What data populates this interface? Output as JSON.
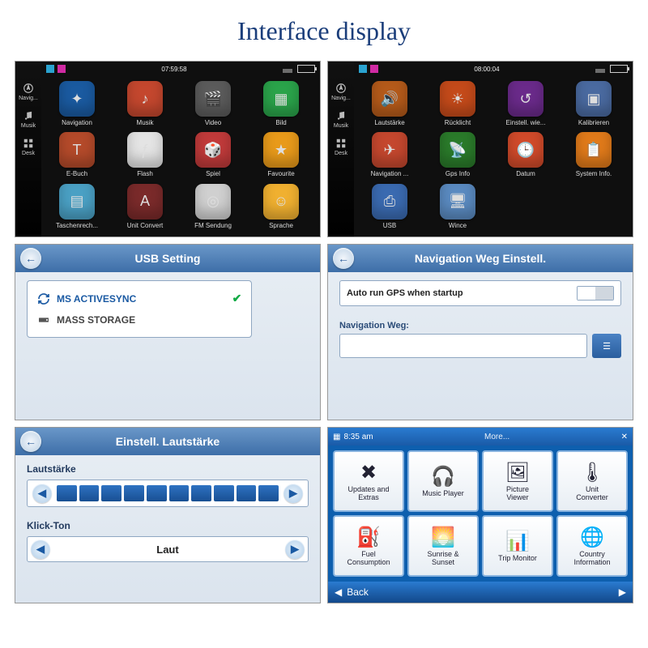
{
  "title": "Interface display",
  "home1": {
    "time": "07:59:58",
    "side": [
      {
        "label": "Navig...",
        "icon": "compass"
      },
      {
        "label": "Musik",
        "icon": "music"
      },
      {
        "label": "Desk",
        "icon": "grid"
      }
    ],
    "apps": [
      {
        "label": "Navigation",
        "bg": "#1a5aa0",
        "glyph": "✦"
      },
      {
        "label": "Musik",
        "bg": "#c4472e",
        "glyph": "♪"
      },
      {
        "label": "Video",
        "bg": "#5b5b5b",
        "glyph": "🎬"
      },
      {
        "label": "Bild",
        "bg": "#2aa34a",
        "glyph": "▦"
      },
      {
        "label": "E-Buch",
        "bg": "#b44a2a",
        "glyph": "T"
      },
      {
        "label": "Flash",
        "bg": "#e4e4e4",
        "glyph": "ƒ"
      },
      {
        "label": "Spiel",
        "bg": "#c03a3a",
        "glyph": "🎲"
      },
      {
        "label": "Favourite",
        "bg": "#e89a1a",
        "glyph": "★"
      },
      {
        "label": "Taschenrech...",
        "bg": "#4aa0c4",
        "glyph": "▤"
      },
      {
        "label": "Unit Convert",
        "bg": "#7a2a2a",
        "glyph": "A"
      },
      {
        "label": "FM Sendung",
        "bg": "#d0d0d0",
        "glyph": "◎"
      },
      {
        "label": "Sprache",
        "bg": "#f0b030",
        "glyph": "☺"
      }
    ]
  },
  "home2": {
    "time": "08:00:04",
    "side": [
      {
        "label": "Navig...",
        "icon": "compass"
      },
      {
        "label": "Musik",
        "icon": "music"
      },
      {
        "label": "Desk",
        "icon": "grid"
      }
    ],
    "apps": [
      {
        "label": "Lautstärke",
        "bg": "#b45a1a",
        "glyph": "🔊"
      },
      {
        "label": "Rücklicht",
        "bg": "#c44a1a",
        "glyph": "☀"
      },
      {
        "label": "Einstell. wie...",
        "bg": "#6a2a8a",
        "glyph": "↺"
      },
      {
        "label": "Kalibrieren",
        "bg": "#4a6aa0",
        "glyph": "▣"
      },
      {
        "label": "Navigation ...",
        "bg": "#c4472e",
        "glyph": "✈"
      },
      {
        "label": "Gps Info",
        "bg": "#2a7a2a",
        "glyph": "📡"
      },
      {
        "label": "Datum",
        "bg": "#d04a2a",
        "glyph": "🕒"
      },
      {
        "label": "System Info.",
        "bg": "#e07a1a",
        "glyph": "📋"
      },
      {
        "label": "USB",
        "bg": "#3a6ab0",
        "glyph": "⎙"
      },
      {
        "label": "Wince",
        "bg": "#5a8ac0",
        "glyph": "🖥"
      }
    ]
  },
  "usb": {
    "title": "USB Setting",
    "options": [
      {
        "label": "MS ACTIVESYNC",
        "icon": "sync",
        "checked": true
      },
      {
        "label": "MASS STORAGE",
        "icon": "drive",
        "checked": false
      }
    ]
  },
  "nav": {
    "title": "Navigation Weg Einstell.",
    "autorun_label": "Auto run GPS when startup",
    "path_label": "Navigation Weg:"
  },
  "vol": {
    "title": "Einstell. Lautstärke",
    "volume_label": "Lautstärke",
    "level": 10,
    "max": 10,
    "click_label": "Klick-Ton",
    "click_value": "Laut"
  },
  "more": {
    "time": "8:35 am",
    "title": "More...",
    "back_label": "Back",
    "apps": [
      {
        "label": "Updates and\nExtras",
        "glyph": "✖"
      },
      {
        "label": "Music Player",
        "glyph": "🎧"
      },
      {
        "label": "Picture\nViewer",
        "glyph": "🖼"
      },
      {
        "label": "Unit\nConverter",
        "glyph": "🌡"
      },
      {
        "label": "Fuel\nConsumption",
        "glyph": "⛽"
      },
      {
        "label": "Sunrise &\nSunset",
        "glyph": "🌅"
      },
      {
        "label": "Trip Monitor",
        "glyph": "📊"
      },
      {
        "label": "Country\nInformation",
        "glyph": "🌐"
      }
    ]
  }
}
